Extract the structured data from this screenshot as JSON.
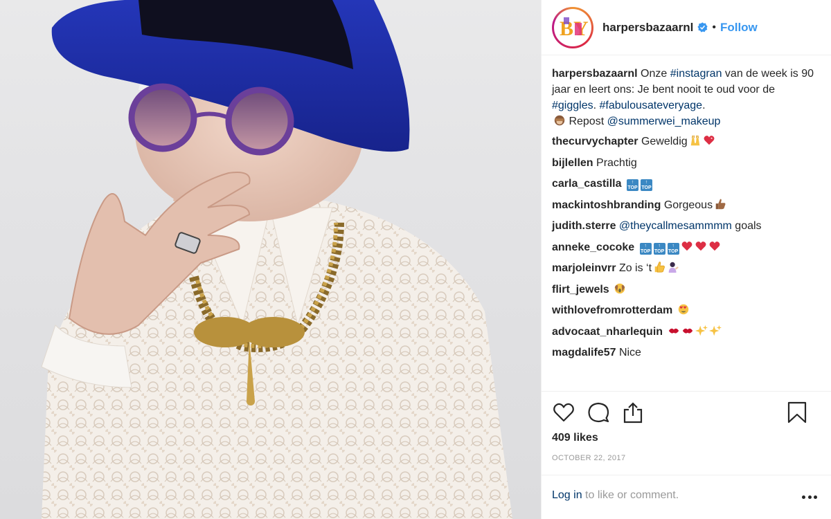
{
  "account": {
    "handle": "harpersbazaarnl",
    "dot": "•",
    "follow_label": "Follow",
    "logo_letters": "BY"
  },
  "caption": {
    "author": "harpersbazaarnl",
    "text_1": " Onze ",
    "tag_1": "#instagran",
    "text_2": " van de week is 90 jaar en leert ons: Je bent nooit te oud voor de ",
    "tag_2": "#giggles",
    "text_3": ". ",
    "tag_3": "#fabulousateveryage",
    "text_4": ".",
    "text_5": "Repost ",
    "mention": "@summerwei_makeup"
  },
  "comments": [
    {
      "user": "thecurvychapter",
      "text": "Geweldig"
    },
    {
      "user": "bijlellen",
      "text": "Prachtig"
    },
    {
      "user": "carla_castilla",
      "text": ""
    },
    {
      "user": "mackintoshbranding",
      "text": "Gorgeous"
    },
    {
      "user": "judith.sterre",
      "mention": "@theycallmesammmm",
      "text": " goals"
    },
    {
      "user": "anneke_cocoke",
      "text": ""
    },
    {
      "user": "marjoleinvrr",
      "text": "Zo is ‘t"
    },
    {
      "user": "flirt_jewels",
      "text": ""
    },
    {
      "user": "withlovefromrotterdam",
      "text": ""
    },
    {
      "user": "advocaat_nharlequin",
      "text": ""
    },
    {
      "user": "magdalife57",
      "text": "Nice"
    }
  ],
  "top_emoji_text": "TOP",
  "likes": "409 likes",
  "date": "OCTOBER 22, 2017",
  "login": {
    "link": "Log in",
    "rest": " to like or comment."
  },
  "colors": {
    "link_blue": "#3897f0",
    "hashtag": "#003569",
    "hat_blue": "#1f2ea8"
  },
  "icons": [
    "heart-icon",
    "comment-icon",
    "share-icon",
    "bookmark-icon",
    "verified-badge-icon",
    "more-options-icon"
  ]
}
